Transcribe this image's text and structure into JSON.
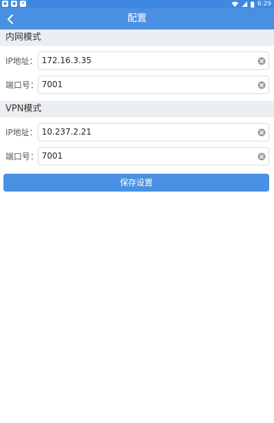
{
  "status_bar": {
    "time": "6:29",
    "left_icons": [
      "app-notification-icon",
      "app-notification-icon",
      "close-notification-icon"
    ],
    "right_icons": [
      "wifi-icon",
      "signal-icon",
      "battery-icon"
    ]
  },
  "app_bar": {
    "title": "配置",
    "back_icon": "chevron-left-icon"
  },
  "intranet": {
    "header": "内网模式",
    "ip_label": "IP地址：",
    "ip_value": "172.16.3.35",
    "port_label": "端口号：",
    "port_value": "7001"
  },
  "vpn": {
    "header": "VPN模式",
    "ip_label": "IP地址：",
    "ip_value": "10.237.2.21",
    "port_label": "端口号：",
    "port_value": "7001"
  },
  "save_label": "保存设置",
  "colors": {
    "accent": "#4a90e2",
    "status_bar": "#3f88df",
    "section_bg": "#ebeef2"
  }
}
